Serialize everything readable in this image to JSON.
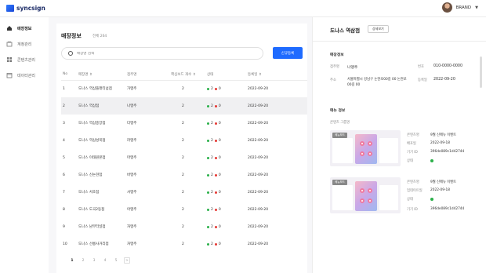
{
  "header": {
    "logo_text": "syncsign",
    "user_name": "BRAND"
  },
  "sidebar": {
    "items": [
      {
        "label": "매장정보",
        "icon": "home-icon",
        "active": true
      },
      {
        "label": "계정관리",
        "icon": "user-icon",
        "active": false
      },
      {
        "label": "콘텐츠관리",
        "icon": "grid-icon",
        "active": false
      },
      {
        "label": "데이터관리",
        "icon": "calendar-icon",
        "active": false
      }
    ]
  },
  "main": {
    "title": "매장정보",
    "count": "전체 264",
    "search_placeholder": "매장명 검색",
    "new_button": "신규등록",
    "columns": [
      "No",
      "매장명",
      "점주명",
      "핵심보드 개수",
      "상태",
      "등록일"
    ],
    "rows": [
      {
        "no": "1",
        "store": "도나스 역삼플래티넘점",
        "owner": "가맹주",
        "count": "2",
        "on": "2",
        "off": "0",
        "date": "2022-09-20"
      },
      {
        "no": "2",
        "store": "도나스 역삼점",
        "owner": "나맹주",
        "count": "2",
        "on": "2",
        "off": "0",
        "date": "2022-09-20"
      },
      {
        "no": "3",
        "store": "도나스 역삼중앙점",
        "owner": "다맹주",
        "count": "2",
        "on": "2",
        "off": "0",
        "date": "2022-09-20"
      },
      {
        "no": "4",
        "store": "도나스 역삼성북점",
        "owner": "라맹주",
        "count": "2",
        "on": "2",
        "off": "0",
        "date": "2022-09-20"
      },
      {
        "no": "5",
        "store": "도나스 이태원본점",
        "owner": "마맹주",
        "count": "2",
        "on": "2",
        "off": "0",
        "date": "2022-09-20"
      },
      {
        "no": "6",
        "store": "도나스 신논현점",
        "owner": "바맹주",
        "count": "2",
        "on": "2",
        "off": "0",
        "date": "2022-09-20"
      },
      {
        "no": "7",
        "store": "도나스 서초점",
        "owner": "사맹주",
        "count": "2",
        "on": "2",
        "off": "0",
        "date": "2022-09-20"
      },
      {
        "no": "8",
        "store": "도나스 도곡2동점",
        "owner": "아맹주",
        "count": "2",
        "on": "2",
        "off": "0",
        "date": "2022-09-20"
      },
      {
        "no": "9",
        "store": "도나스 남부터널점",
        "owner": "자맹주",
        "count": "2",
        "on": "2",
        "off": "0",
        "date": "2022-09-20"
      },
      {
        "no": "10",
        "store": "도나스 선릉사거리점",
        "owner": "차맹주",
        "count": "2",
        "on": "2",
        "off": "0",
        "date": "2022-09-20"
      }
    ],
    "pages": [
      "1",
      "2",
      "3",
      "4",
      "5",
      ">"
    ]
  },
  "detail": {
    "title": "도나스 역삼점",
    "detail_button": "상세보기",
    "store_section": "매장정보",
    "owner_label": "점주명",
    "owner_value": "나맹주",
    "phone_label": "번호",
    "phone_value": "010-0000-0000",
    "addr_label": "주소",
    "addr_value": "서울특별시 강남구 논현로00길 00 논현로00길 00",
    "date_label": "등록일",
    "date_value": "2022-09-20",
    "board_section": "매뉴 정보",
    "group_label": "콘텐츠 그룹명",
    "boards": [
      {
        "tag": "메뉴보드",
        "c1_label": "콘텐츠명",
        "c1": "9월 신메뉴 이벤트",
        "c2_label": "배포일",
        "c2": "2022-09-18",
        "c3_label": "기기 ID",
        "c3": "396de089c1d42744",
        "c4_label": "상태"
      },
      {
        "tag": "메뉴보드",
        "c1_label": "콘텐츠명",
        "c1": "9월 신메뉴 이벤트",
        "c2_label": "업데이트일",
        "c2": "2022-09-18",
        "c3_label": "상태",
        "c4_label": "기기 ID",
        "c4": "396de089c1d42744"
      }
    ]
  },
  "colors": {
    "accent": "#1f6bff",
    "on": "#2bb04a",
    "off": "#e53935"
  }
}
